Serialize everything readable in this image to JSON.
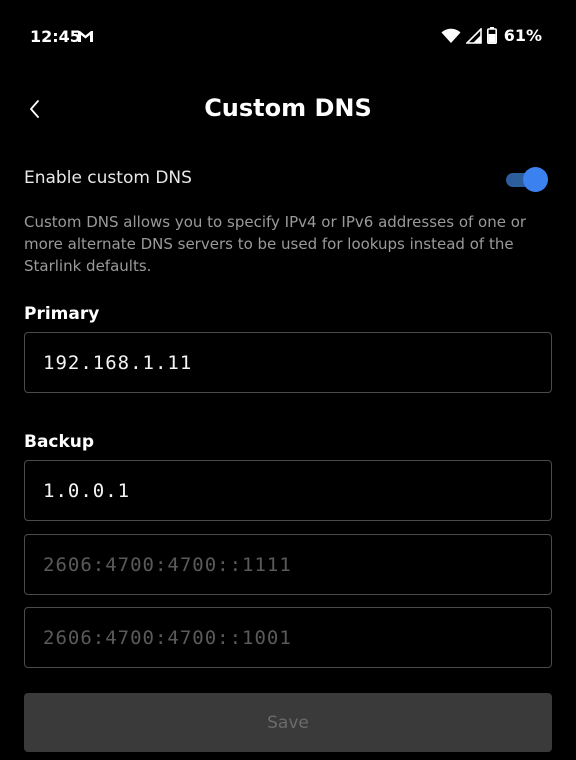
{
  "status_bar": {
    "time": "12:45",
    "notification_icon": "gmail-icon",
    "wifi_icon": "wifi-icon",
    "signal_icon": "signal-icon",
    "battery_icon": "battery-icon",
    "battery_percent": "61%"
  },
  "header": {
    "back_icon": "chevron-left-icon",
    "title": "Custom DNS"
  },
  "settings": {
    "enable_label": "Enable custom DNS",
    "enable_on": true,
    "description": "Custom DNS allows you to specify IPv4 or IPv6 addresses of one or more alternate DNS servers to be used for lookups instead of the Starlink defaults."
  },
  "primary": {
    "label": "Primary",
    "value": "192.168.1.11"
  },
  "backup": {
    "label": "Backup",
    "value": "1.0.0.1",
    "ipv6_1_placeholder": "2606:4700:4700::1111",
    "ipv6_2_placeholder": "2606:4700:4700::1001"
  },
  "actions": {
    "save_label": "Save"
  },
  "colors": {
    "background": "#000000",
    "toggle_accent": "#3b82f0",
    "field_border": "#4b4b4b",
    "save_disabled_bg": "#3a3a3a"
  }
}
